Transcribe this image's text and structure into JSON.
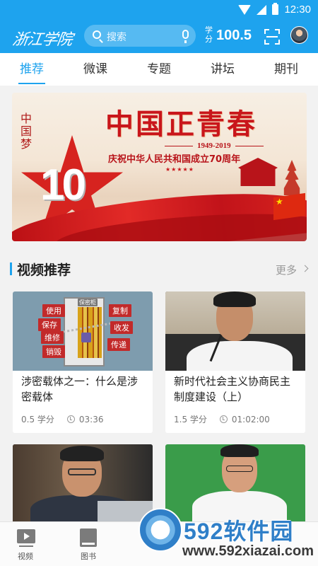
{
  "status_bar": {
    "time": "12:30"
  },
  "header": {
    "logo_text": "浙江学院",
    "search_placeholder": "搜索",
    "credit_label": "学分",
    "credit_value": "100.5"
  },
  "tabs": [
    {
      "label": "推荐",
      "active": true
    },
    {
      "label": "微课",
      "active": false
    },
    {
      "label": "专题",
      "active": false
    },
    {
      "label": "讲坛",
      "active": false
    },
    {
      "label": "期刊",
      "active": false
    }
  ],
  "banner": {
    "brand": "中国梦",
    "big_number": "10",
    "title": "中国正青春",
    "years": "1949-2019",
    "subtitle": "庆祝中华人民共和国成立70周年",
    "stars": "★★★★★"
  },
  "section": {
    "title": "视频推荐",
    "more_label": "更多"
  },
  "videos": [
    {
      "title": "涉密载体之一：什么是涉密载体",
      "credit": "0.5 学分",
      "duration": "03:36",
      "tags": [
        "使用",
        "保存",
        "维修",
        "销毁",
        "复制",
        "收发",
        "传递",
        "保密柜"
      ]
    },
    {
      "title": "新时代社会主义协商民主制度建设（上）",
      "credit": "1.5 学分",
      "duration": "01:02:00"
    },
    {
      "title": "",
      "credit": "",
      "duration": ""
    },
    {
      "title": "",
      "credit": "",
      "duration": ""
    }
  ],
  "bottom_nav": [
    {
      "label": "视频",
      "icon": "video-icon"
    },
    {
      "label": "图书",
      "icon": "book-icon"
    }
  ],
  "watermark": {
    "brand": "592软件园",
    "url": "www.592xiazai.com"
  },
  "colors": {
    "primary": "#1ea3ee",
    "banner_red": "#c9161b"
  }
}
